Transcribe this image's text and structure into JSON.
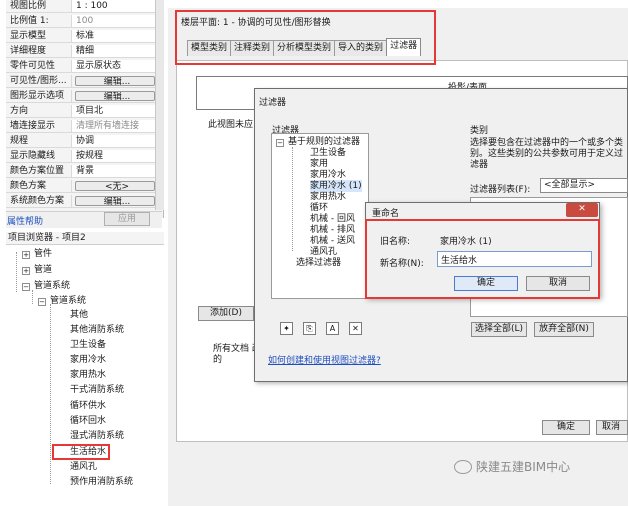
{
  "properties": {
    "rows": [
      {
        "key": "视图比例",
        "value": "1 : 100",
        "grey": false,
        "button": false
      },
      {
        "key": "比例值 1:",
        "value": "100",
        "grey": true,
        "button": false
      },
      {
        "key": "显示模型",
        "value": "标准",
        "grey": false,
        "button": false
      },
      {
        "key": "详细程度",
        "value": "精细",
        "grey": false,
        "button": false
      },
      {
        "key": "零件可见性",
        "value": "显示原状态",
        "grey": false,
        "button": false
      },
      {
        "key": "可见性/图形...",
        "value": "编辑...",
        "grey": false,
        "button": true
      },
      {
        "key": "图形显示选项",
        "value": "编辑...",
        "grey": false,
        "button": true
      },
      {
        "key": "方向",
        "value": "项目北",
        "grey": false,
        "button": false
      },
      {
        "key": "墙连接显示",
        "value": "清理所有墙连接",
        "grey": true,
        "button": false
      },
      {
        "key": "规程",
        "value": "协调",
        "grey": false,
        "button": false
      },
      {
        "key": "显示隐藏线",
        "value": "按规程",
        "grey": false,
        "button": false
      },
      {
        "key": "颜色方案位置",
        "value": "背景",
        "grey": false,
        "button": false
      },
      {
        "key": "颜色方案",
        "value": "<无>",
        "grey": false,
        "button": true
      },
      {
        "key": "系统颜色方案",
        "value": "编辑...",
        "grey": false,
        "button": true
      }
    ],
    "help_link": "属性帮助",
    "apply_label": "应用"
  },
  "project_browser": {
    "title": "项目浏览器 - 项目2",
    "nodes": [
      {
        "label": "管件",
        "expander": "+"
      },
      {
        "label": "管道",
        "expander": "+"
      },
      {
        "label": "管道系统",
        "expander": "-"
      },
      {
        "label": "管道系统",
        "expander": "-"
      }
    ],
    "items": [
      "其他",
      "其他消防系统",
      "卫生设备",
      "家用冷水",
      "家用热水",
      "干式消防系统",
      "循环供水",
      "循环回水",
      "湿式消防系统",
      "生活给水",
      "通风孔",
      "预作用消防系统"
    ],
    "selected_item": "生活给水"
  },
  "view": {
    "title": "楼层平面: 1 - 协调的可见性/图形替换",
    "tabs": [
      "模型类别",
      "注释类别",
      "分析模型类别",
      "导入的类别",
      "过滤器"
    ],
    "active_tab": "过滤器",
    "table_header": "投影/表面",
    "view_visible_label": "此视图未应",
    "add_label": "添加(D)",
    "footnote": "所有文档 改的",
    "ok_label": "确定",
    "cancel_label": "取消"
  },
  "filters_dialog": {
    "title": "过滤器",
    "filters_label": "过滤器",
    "tree": {
      "root": "基于规则的过滤器",
      "children": [
        "卫生设备",
        "家用",
        "家用冷水",
        "家用冷水 (1)",
        "家用热水",
        "循环",
        "机械 - 回风",
        "机械 - 排风",
        "机械 - 送风",
        "通风孔"
      ],
      "selected": "家用冷水 (1)",
      "selection_filters": "选择过滤器"
    },
    "category_label": "类别",
    "category_desc": "选择要包含在过滤器中的一个或多个类别。这些类别的公共参数可用于定义过滤器",
    "filter_list_label": "过滤器列表(F):",
    "filter_list_value": "<全部显示>",
    "select_all_label": "选择全部(L)",
    "deselect_all_label": "放弃全部(N)",
    "help_link": "如何创建和使用视图过滤器?"
  },
  "rename_dialog": {
    "title": "重命名",
    "close_label": "✕",
    "old_name_label": "旧名称:",
    "old_name_value": "家用冷水 (1)",
    "new_name_label": "新名称(N):",
    "new_name_value": "生活给水",
    "ok_label": "确定",
    "cancel_label": "取消"
  },
  "watermark": "陕建五建BIM中心",
  "colors": {
    "highlight": "#e53935",
    "link": "#1f4fbf",
    "selection": "#3399ff"
  }
}
